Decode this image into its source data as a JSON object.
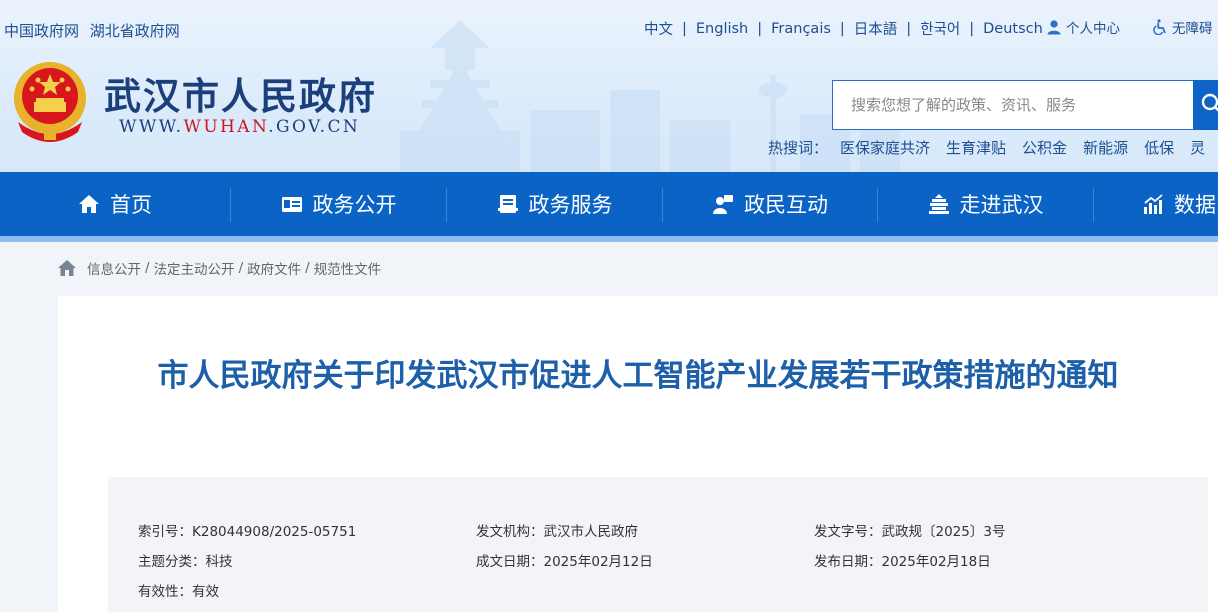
{
  "top_links": [
    "中国政府网",
    "湖北省政府网"
  ],
  "languages": [
    "中文",
    "English",
    "Français",
    "日本語",
    "한국어",
    "Deutsch"
  ],
  "language_separator": "|",
  "user_center": "个人中心",
  "accessibility": "无障碍",
  "site": {
    "title": "武汉市人民政府",
    "url_prefix": "WWW.",
    "url_highlight": "WUHAN",
    "url_suffix": ".GOV.CN"
  },
  "search": {
    "placeholder": "搜索您想了解的政策、资讯、服务"
  },
  "hot_search": {
    "label": "热搜词：",
    "keywords": [
      "医保家庭共济",
      "生育津贴",
      "公积金",
      "新能源",
      "低保",
      "灵"
    ]
  },
  "nav": [
    {
      "label": "首页",
      "icon": "home-icon"
    },
    {
      "label": "政务公开",
      "icon": "id-card-icon"
    },
    {
      "label": "政务服务",
      "icon": "document-icon"
    },
    {
      "label": "政民互动",
      "icon": "chat-user-icon"
    },
    {
      "label": "走进武汉",
      "icon": "building-icon"
    },
    {
      "label": "数据",
      "icon": "chart-icon"
    }
  ],
  "breadcrumb": [
    "信息公开",
    "法定主动公开",
    "政府文件",
    "规范性文件"
  ],
  "breadcrumb_separator": "/",
  "document": {
    "title": "市人民政府关于印发武汉市促进人工智能产业发展若干政策措施的通知",
    "meta": [
      {
        "label": "索引号：",
        "value": "K28044908/2025-05751"
      },
      {
        "label": "发文机构：",
        "value": "武汉市人民政府"
      },
      {
        "label": "发文字号：",
        "value": "武政规〔2025〕3号"
      },
      {
        "label": "主题分类：",
        "value": "科技"
      },
      {
        "label": "成文日期：",
        "value": "2025年02月12日"
      },
      {
        "label": "发布日期：",
        "value": "2025年02月18日"
      },
      {
        "label": "有效性：",
        "value": "有效"
      }
    ]
  },
  "colors": {
    "nav_bg": "#0b64c5",
    "title_blue": "#1d5fa8",
    "link_blue": "#1d4f91",
    "url_red": "#c8161d"
  }
}
